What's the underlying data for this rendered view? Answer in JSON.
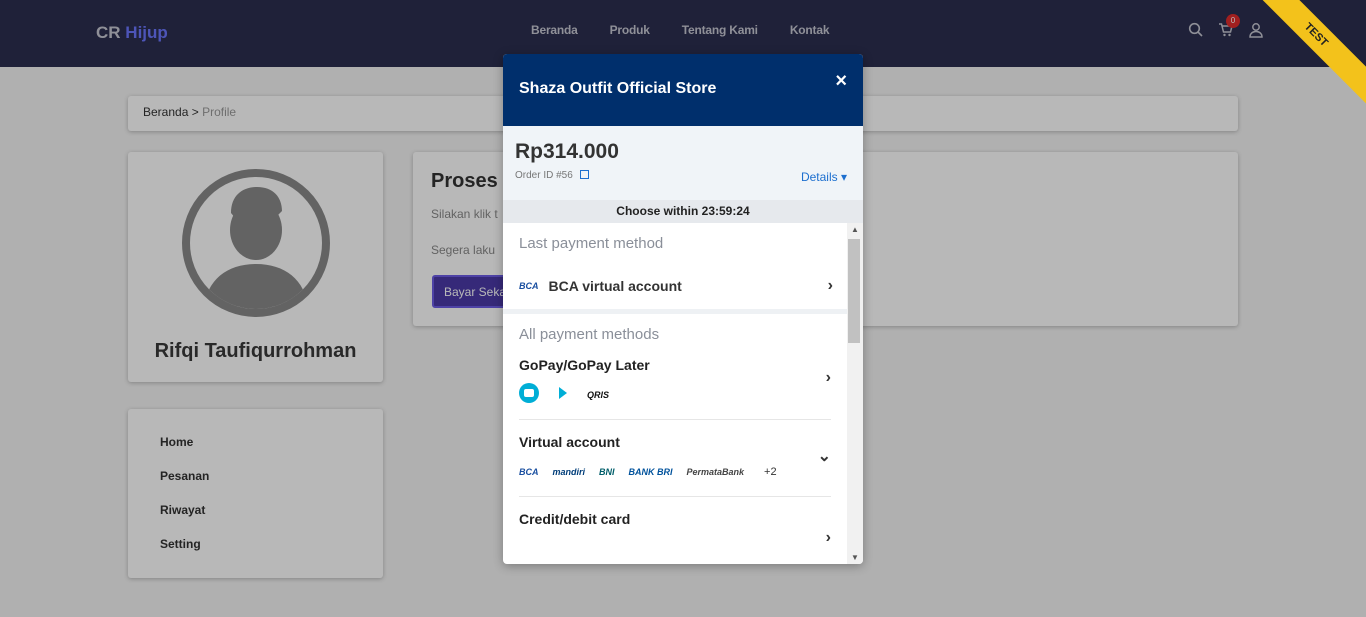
{
  "navbar": {
    "brand_prefix": "CR",
    "brand_accent": "Hijup",
    "links": [
      "Beranda",
      "Produk",
      "Tentang Kami",
      "Kontak"
    ],
    "cart_count": "0",
    "ribbon": "TEST"
  },
  "breadcrumb": {
    "home": "Beranda",
    "separator": ">",
    "current": "Profile"
  },
  "profile": {
    "name": "Rifqi Taufiqurrohman"
  },
  "menu": [
    "Home",
    "Pesanan",
    "Riwayat",
    "Setting"
  ],
  "process": {
    "title": "Proses",
    "line1": "Silakan klik t",
    "line2": "Segera laku",
    "button": "Bayar Seka"
  },
  "modal": {
    "title": "Shaza Outfit Official Store",
    "close": "×",
    "amount": "Rp314.000",
    "order_id": "Order ID #56",
    "details": "Details ▾",
    "timer_label": "Choose within",
    "timer_value": "23:59:24",
    "last_payment_title": "Last payment method",
    "last_payment_name": "BCA virtual account",
    "all_methods_title": "All payment methods",
    "groups": [
      {
        "title": "GoPay/GoPay Later",
        "chevron": "›"
      },
      {
        "title": "Virtual account",
        "chevron": "⌄",
        "more": "+2"
      },
      {
        "title": "Credit/debit card",
        "chevron": "›"
      }
    ],
    "bank_logos": [
      "BCA",
      "mandiri",
      "BNI",
      "BANK BRI",
      "PermataBank"
    ],
    "qris_logo": "QRIS"
  },
  "colors": {
    "navbar": "#2b2e4f",
    "modal_header": "#002f6c",
    "link_blue": "#1d6fcf",
    "ribbon": "#f3c21b",
    "button": "#4b3aa8"
  }
}
